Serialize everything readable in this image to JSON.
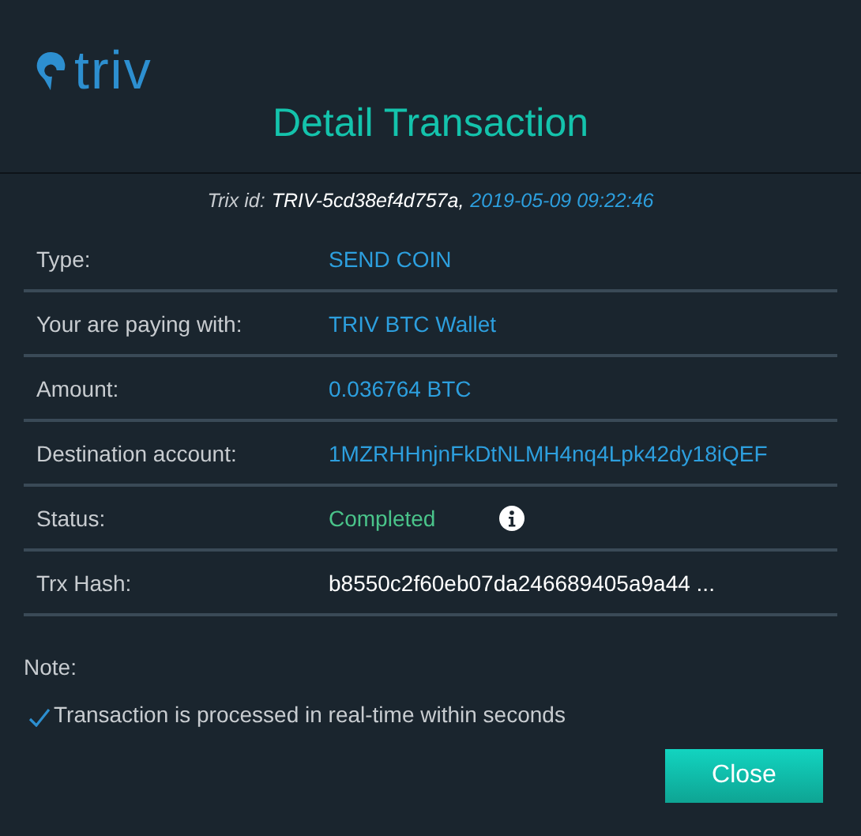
{
  "logo": {
    "text": "triv"
  },
  "title": "Detail Transaction",
  "trix": {
    "label": "Trix id:",
    "id": "TRIV-5cd38ef4d757a,",
    "date": "2019-05-09 09:22:46"
  },
  "rows": [
    {
      "label": "Type:",
      "value": "SEND COIN",
      "kind": "link"
    },
    {
      "label": "Your are paying with:",
      "value": "TRIV BTC Wallet",
      "kind": "link"
    },
    {
      "label": "Amount:",
      "value": "0.036764 BTC",
      "kind": "link"
    },
    {
      "label": "Destination account:",
      "value": "1MZRHHnjnFkDtNLMH4nq4Lpk42dy18iQEF",
      "kind": "link"
    },
    {
      "label": "Status:",
      "value": "Completed",
      "kind": "status"
    },
    {
      "label": "Trx Hash:",
      "value": "b8550c2f60eb07da246689405a9a44 ...",
      "kind": "plain"
    }
  ],
  "note": {
    "title": "Note:",
    "items": [
      "Transaction is processed in real-time within seconds"
    ]
  },
  "buttons": [
    "Close"
  ]
}
